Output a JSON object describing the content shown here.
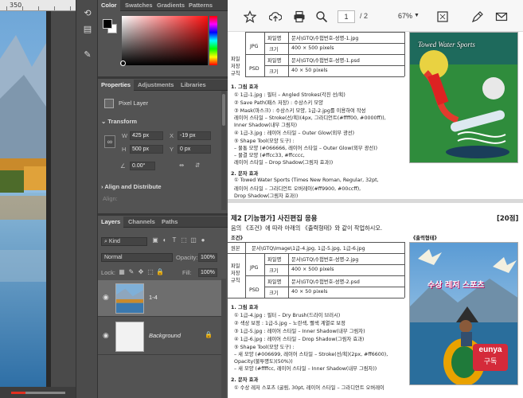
{
  "photoshop": {
    "ruler": {
      "mark": "350"
    },
    "color_panel": {
      "tabs": [
        "Color",
        "Swatches",
        "Gradients",
        "Patterns"
      ],
      "foreground": "#000000",
      "background": "#ffffff"
    },
    "properties_panel": {
      "tabs": [
        "Properties",
        "Adjustments",
        "Libraries"
      ],
      "layer_type": "Pixel Layer",
      "transform_label": "Transform",
      "w_label": "W",
      "w_value": "425 px",
      "h_label": "H",
      "h_value": "500 px",
      "x_label": "X",
      "x_value": "-19 px",
      "y_label": "Y",
      "y_value": "0 px",
      "angle_value": "0.00°",
      "align_label": "Align and Distribute",
      "align_sub": "Align:"
    },
    "layers_panel": {
      "tabs": [
        "Layers",
        "Channels",
        "Paths"
      ],
      "filter_label": "Kind",
      "blend_mode": "Normal",
      "opacity_label": "Opacity:",
      "opacity_value": "100%",
      "lock_label": "Lock:",
      "fill_label": "Fill:",
      "fill_value": "100%",
      "layers": [
        {
          "name": "1-4",
          "selected": true
        },
        {
          "name": "Background",
          "selected": false,
          "locked": true
        }
      ]
    }
  },
  "pdf_viewer": {
    "toolbar": {
      "page_current": "1",
      "page_total": "/ 2",
      "zoom": "67%"
    },
    "doc_top": {
      "side_label": "파일 저장 규칙",
      "table": [
        {
          "fmt": "JPG",
          "r1_label": "파일명",
          "r1_val": "문서\\GTQ\\수험번호-성명-1.jpg",
          "r2_label": "크기",
          "r2_val": "400 × 500 pixels"
        },
        {
          "fmt": "PSD",
          "r1_label": "파일명",
          "r1_val": "문서\\GTQ\\수험번호-성명-1.psd",
          "r2_label": "크기",
          "r2_val": "40 × 50 pixels"
        }
      ],
      "section1": "1. 그림 효과",
      "lines1": [
        "① 1급-1.jpg : 필터 – Angled Strokes(각진 선/획)",
        "② Save Path(패스 저장) : 수상스키 모양",
        "③ Mask(마스크) : 수상스키 모양, 1급-2.jpg를 이용하여 작성",
        "   레이어 스타일 – Stroke(선/획)(4px, 그라디언트(#ffff00, #0000ff)),",
        "   Inner Shadow(내부 그림자)",
        "④ 1급-3.jpg : 레이어 스타일 – Outer Glow(외부 광선)",
        "⑤ Shape Tool(모양 도구) :",
        "   – 물통 모양 (#066666, 레이어 스타일 – Outer Glow(외부 광선))",
        "   – 물결 모양 (#ffcc33, #ffcccc,",
        "     레이어 스타일 – Drop Shadow(그림자 효과))"
      ],
      "section2": "2. 문자 효과",
      "lines2": [
        "① Towed Water Sports (Times New Roman, Regular, 32pt,",
        "   레이어 스타일 – 그라디언트 오버레이(#ff9900, #00ccff),",
        "   Drop Shadow(그림자 효과))"
      ],
      "image_title": "Towed Water Sports"
    },
    "doc_bottom": {
      "heading": "제2 [기능평가] 사진편집 응용",
      "score": "[20점]",
      "instruction": "음의 《조건》에 따라 아래의 《출력형태》와 같이 작업하시오.",
      "conditions": "조건》",
      "output_label": "《출력형태》",
      "orig_label": "원본",
      "orig_path": "문서\\GTQ\\Image\\1급-4.jpg, 1급-5.jpg, 1급-6.jpg",
      "side_label": "파일 저장 규칙",
      "table": [
        {
          "fmt": "JPG",
          "r1_label": "파일명",
          "r1_val": "문서\\GTQ\\수험번호-성명-2.jpg",
          "r2_label": "크기",
          "r2_val": "400 × 500 pixels"
        },
        {
          "fmt": "PSD",
          "r1_label": "파일명",
          "r1_val": "문서\\GTQ\\수험번호-성명-2.psd",
          "r2_label": "크기",
          "r2_val": "40 × 50 pixels"
        }
      ],
      "section1": "1. 그림 효과",
      "lines1": [
        "① 1급-4.jpg : 필터 – Dry Brush(드라이 브러시)",
        "② 색상 보정 : 1급-5.jpg – 노란색, 빨색 계열로 보정",
        "③ 1급-5.jpg : 레이어 스타일 – Inner Shadow(내부 그림자)",
        "④ 1급-6.jpg : 레이어 스타일 – Drop Shadow(그림자 효과)",
        "⑤ Shape Tool(모양 도구) :",
        "   – 새 모양 (#006699, 레이어 스타일 – Stroke(선/획)(2px, #ff6600),",
        "     Opacity(불투명도)(50%))",
        "   – 새 모양 (#ffffcc, 레이어 스타일 – Inner Shadow(내부 그림자))"
      ],
      "section2": "2. 문자 효과",
      "lines2": [
        "① 수상 레저 스포츠 (굴림, 30pt, 레이어 스타일 – 그라디언트 오버레이"
      ],
      "image_title": "수상 레저 스포츠"
    },
    "watermark": {
      "line1": "eunya",
      "line2": "구독"
    }
  }
}
